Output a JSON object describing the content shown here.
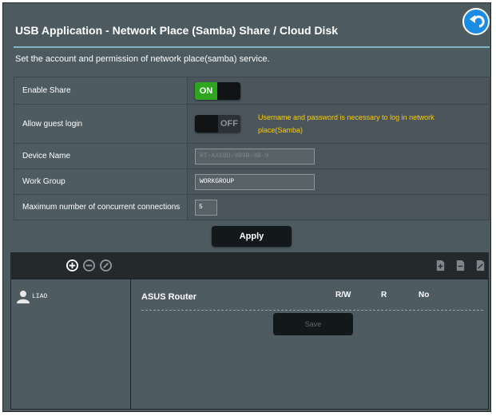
{
  "header": {
    "title": "USB Application - Network Place (Samba) Share / Cloud Disk",
    "subtitle": "Set the account and permission of network place(samba) service."
  },
  "settings": {
    "enable_share": {
      "label": "Enable Share",
      "toggle_text": "ON"
    },
    "guest_login": {
      "label": "Allow guest login",
      "toggle_text": "OFF",
      "warning": "Username and password is necessary to log in network place(Samba)"
    },
    "device_name": {
      "label": "Device Name",
      "value": "RT-AX68U-9B9B-9B-9"
    },
    "work_group": {
      "label": "Work Group",
      "value": "WORKGROUP"
    },
    "max_connections": {
      "label": "Maximum number of concurrent connections",
      "value": "5"
    }
  },
  "apply_label": "Apply",
  "accounts": [
    {
      "name": "LIAO"
    }
  ],
  "permissions": {
    "device": "ASUS Router",
    "columns": [
      "R/W",
      "R",
      "No"
    ],
    "save_label": "Save"
  },
  "icons": {
    "back": "back-arrow-icon",
    "add_account": "add-circle-icon",
    "delete_account": "minus-circle-icon",
    "edit_account": "edit-circle-icon",
    "add_folder": "add-folder-icon",
    "delete_folder": "delete-folder-icon",
    "edit_folder": "edit-folder-icon",
    "user": "user-icon"
  },
  "colors": {
    "panel": "#4d5a5f",
    "toggle_on": "#2fa51f",
    "warning": "#ffcc00",
    "accent": "#1b8ce3",
    "divider": "#82b5c3"
  }
}
